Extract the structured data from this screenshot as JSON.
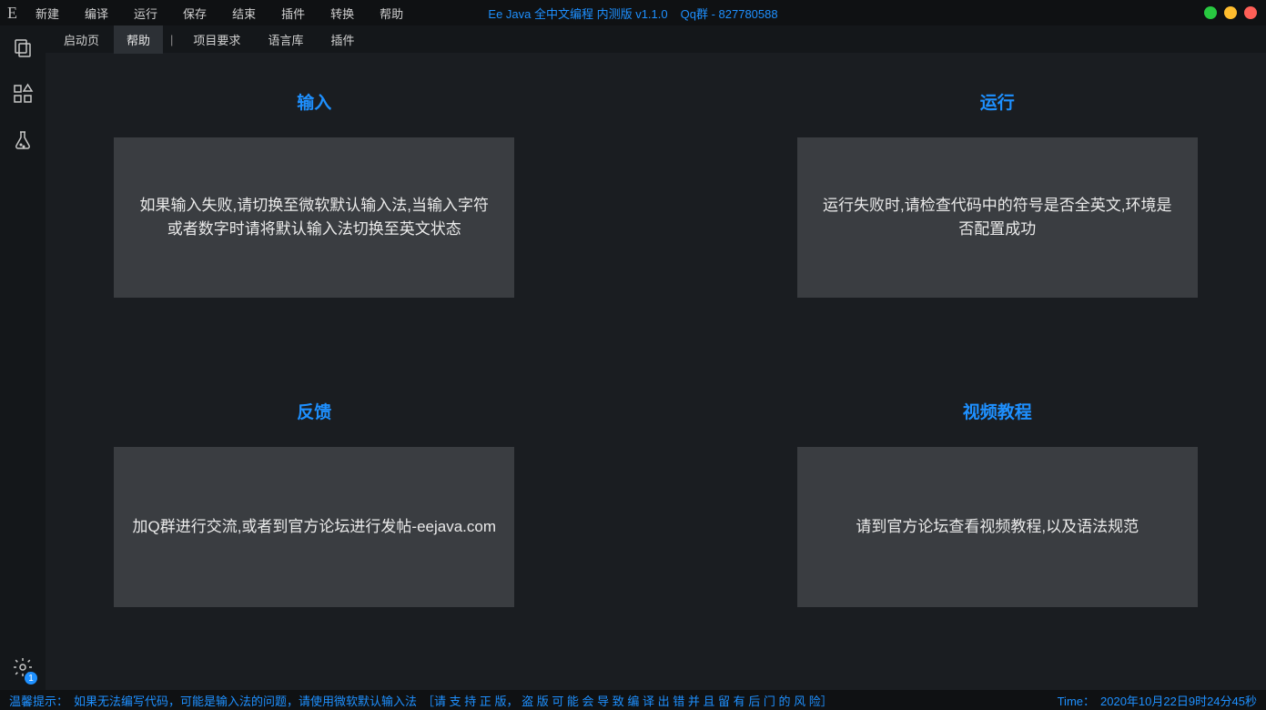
{
  "titlebar": {
    "logo": "E",
    "menu": [
      "新建",
      "编译",
      "运行",
      "保存",
      "结束",
      "插件",
      "转换",
      "帮助"
    ],
    "app_title": "Ee Java 全中文编程 内测版 v1.1.0",
    "qq_group": "Qq群 - 827780588"
  },
  "tabs": {
    "items": [
      "启动页",
      "帮助"
    ],
    "active_index": 1,
    "links": [
      "项目要求",
      "语言库",
      "插件"
    ]
  },
  "sidebar": {
    "badge_count": "1"
  },
  "cards": [
    {
      "title": "输入",
      "body": "如果输入失败,请切换至微软默认输入法,当输入字符或者数字时请将默认输入法切换至英文状态"
    },
    {
      "title": "运行",
      "body": "运行失败时,请检查代码中的符号是否全英文,环境是否配置成功"
    },
    {
      "title": "反馈",
      "body": "加Q群进行交流,或者到官方论坛进行发帖-eejava.com"
    },
    {
      "title": "视频教程",
      "body": "请到官方论坛查看视频教程,以及语法规范"
    }
  ],
  "status": {
    "hint_label": "温馨提示：",
    "hint_body": "如果无法编写代码，可能是输入法的问题，请使用微软默认输入法",
    "bracket": "［请 支 持 正 版， 盗 版 可 能 会 导 致 编 译 出 错 并 且 留 有 后 门 的 风 险］",
    "time_label": "Time：",
    "time_value": "2020年10月22日9时24分45秒"
  }
}
